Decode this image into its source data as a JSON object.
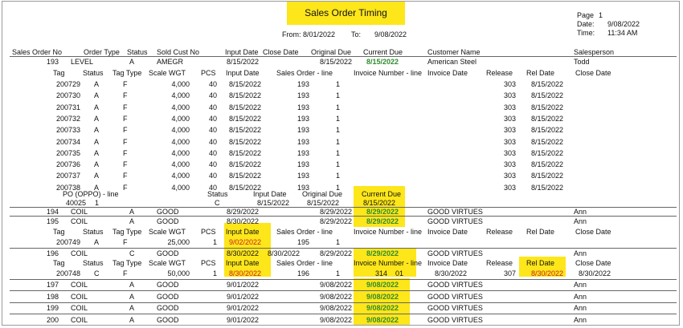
{
  "report": {
    "title": "Sales Order Timing",
    "from_label": "From:",
    "from_date": "8/01/2022",
    "to_label": "To:",
    "to_date": "9/08/2022",
    "page_label": "Page",
    "page_value": "1",
    "date_label": "Date:",
    "date_value": "9/08/2022",
    "time_label": "Time:",
    "time_value": "11:34 AM"
  },
  "header": {
    "sales_order_no": "Sales Order No",
    "order_type": "Order Type",
    "status": "Status",
    "sold_cust_no": "Sold Cust No",
    "input_date": "Input Date",
    "close_date": "Close Date",
    "original_due": "Original Due",
    "current_due": "Current Due",
    "customer_name": "Customer Name",
    "salesperson": "Salesperson"
  },
  "tag_header": {
    "tag": "Tag",
    "status": "Status",
    "tag_type": "Tag Type",
    "scale_wgt": "Scale WGT",
    "pcs": "PCS",
    "input_date": "Input Date",
    "sales_order_line": "Sales Order - line",
    "invoice_number_line": "Invoice Number - line",
    "invoice_date": "Invoice Date",
    "release": "Release",
    "rel_date": "Rel Date",
    "close_date": "Close Date"
  },
  "order_193": {
    "order": "193",
    "type": "LEVEL",
    "status": "A",
    "cust": "AMEGR",
    "input_date": "8/15/2022",
    "original_due": "8/15/2022",
    "current_due": "8/15/2022",
    "customer_name": "American Steel",
    "salesperson": "Todd",
    "tags": [
      {
        "tag": "200729",
        "status": "A",
        "type": "F",
        "wgt": "4,000",
        "pcs": "40",
        "input": "8/15/2022",
        "so": "193",
        "line": "1",
        "release": "303",
        "rel_date": "8/15/2022"
      },
      {
        "tag": "200730",
        "status": "A",
        "type": "F",
        "wgt": "4,000",
        "pcs": "40",
        "input": "8/15/2022",
        "so": "193",
        "line": "1",
        "release": "303",
        "rel_date": "8/15/2022"
      },
      {
        "tag": "200731",
        "status": "A",
        "type": "F",
        "wgt": "4,000",
        "pcs": "40",
        "input": "8/15/2022",
        "so": "193",
        "line": "1",
        "release": "303",
        "rel_date": "8/15/2022"
      },
      {
        "tag": "200732",
        "status": "A",
        "type": "F",
        "wgt": "4,000",
        "pcs": "40",
        "input": "8/15/2022",
        "so": "193",
        "line": "1",
        "release": "303",
        "rel_date": "8/15/2022"
      },
      {
        "tag": "200733",
        "status": "A",
        "type": "F",
        "wgt": "4,000",
        "pcs": "40",
        "input": "8/15/2022",
        "so": "193",
        "line": "1",
        "release": "303",
        "rel_date": "8/15/2022"
      },
      {
        "tag": "200734",
        "status": "A",
        "type": "F",
        "wgt": "4,000",
        "pcs": "40",
        "input": "8/15/2022",
        "so": "193",
        "line": "1",
        "release": "303",
        "rel_date": "8/15/2022"
      },
      {
        "tag": "200735",
        "status": "A",
        "type": "F",
        "wgt": "4,000",
        "pcs": "40",
        "input": "8/15/2022",
        "so": "193",
        "line": "1",
        "release": "303",
        "rel_date": "8/15/2022"
      },
      {
        "tag": "200736",
        "status": "A",
        "type": "F",
        "wgt": "4,000",
        "pcs": "40",
        "input": "8/15/2022",
        "so": "193",
        "line": "1",
        "release": "303",
        "rel_date": "8/15/2022"
      },
      {
        "tag": "200737",
        "status": "A",
        "type": "F",
        "wgt": "4,000",
        "pcs": "40",
        "input": "8/15/2022",
        "so": "193",
        "line": "1",
        "release": "303",
        "rel_date": "8/15/2022"
      },
      {
        "tag": "200738",
        "status": "A",
        "type": "F",
        "wgt": "4,000",
        "pcs": "40",
        "input": "8/15/2022",
        "so": "193",
        "line": "1",
        "release": "303",
        "rel_date": "8/15/2022"
      }
    ],
    "po": {
      "po_label": "PO (OPPO) - line",
      "status_label": "Status",
      "input_label": "Input Date",
      "orig_label": "Original Due",
      "cur_label": "Current Due",
      "po_value": "40025",
      "po_line": "1",
      "status": "C",
      "input": "8/15/2022",
      "orig": "8/15/2022",
      "cur": "8/15/2022"
    }
  },
  "order_194": {
    "order": "194",
    "type": "COIL",
    "status": "A",
    "cust": "GOOD",
    "input_date": "8/29/2022",
    "original_due": "8/29/2022",
    "current_due": "8/29/2022",
    "customer_name": "GOOD VIRTUES",
    "salesperson": "Ann"
  },
  "order_195": {
    "order": "195",
    "type": "COIL",
    "status": "A",
    "cust": "GOOD",
    "input_date": "8/30/2022",
    "original_due": "8/29/2022",
    "current_due": "8/29/2022",
    "customer_name": "GOOD VIRTUES",
    "salesperson": "Ann",
    "tag": {
      "tag": "200749",
      "status": "A",
      "type": "F",
      "wgt": "25,000",
      "pcs": "1",
      "input": "9/02/2022",
      "so": "195",
      "line": "1"
    }
  },
  "order_196": {
    "order": "196",
    "type": "COIL",
    "status": "C",
    "cust": "GOOD",
    "input_date": "8/30/2022",
    "close_date": "8/30/2022",
    "original_due": "8/29/2022",
    "current_due": "8/29/2022",
    "customer_name": "GOOD VIRTUES",
    "salesperson": "Ann",
    "tag": {
      "tag": "200748",
      "status": "C",
      "type": "F",
      "wgt": "50,000",
      "pcs": "1",
      "input": "8/30/2022",
      "so": "196",
      "line": "1",
      "invoice": "314",
      "invoice_line": "01",
      "invoice_date": "8/30/2022",
      "release": "307",
      "rel_date": "8/30/2022",
      "close_date": "8/30/2022"
    }
  },
  "orders_tail": [
    {
      "order": "197",
      "type": "COIL",
      "status": "A",
      "cust": "GOOD",
      "input_date": "9/01/2022",
      "original_due": "9/08/2022",
      "current_due": "9/08/2022",
      "customer_name": "GOOD VIRTUES",
      "salesperson": "Ann"
    },
    {
      "order": "198",
      "type": "COIL",
      "status": "A",
      "cust": "GOOD",
      "input_date": "9/01/2022",
      "original_due": "9/08/2022",
      "current_due": "9/08/2022",
      "customer_name": "GOOD VIRTUES",
      "salesperson": "Ann"
    },
    {
      "order": "199",
      "type": "COIL",
      "status": "A",
      "cust": "GOOD",
      "input_date": "9/01/2022",
      "original_due": "9/08/2022",
      "current_due": "9/08/2022",
      "customer_name": "GOOD VIRTUES",
      "salesperson": "Ann"
    },
    {
      "order": "200",
      "type": "COIL",
      "status": "A",
      "cust": "GOOD",
      "input_date": "9/01/2022",
      "original_due": "9/08/2022",
      "current_due": "9/08/2022",
      "customer_name": "GOOD VIRTUES",
      "salesperson": "Ann"
    }
  ],
  "colors": {
    "highlight": "#fde61a",
    "green_text": "#2e8b2e",
    "red_text": "#c8202a"
  }
}
